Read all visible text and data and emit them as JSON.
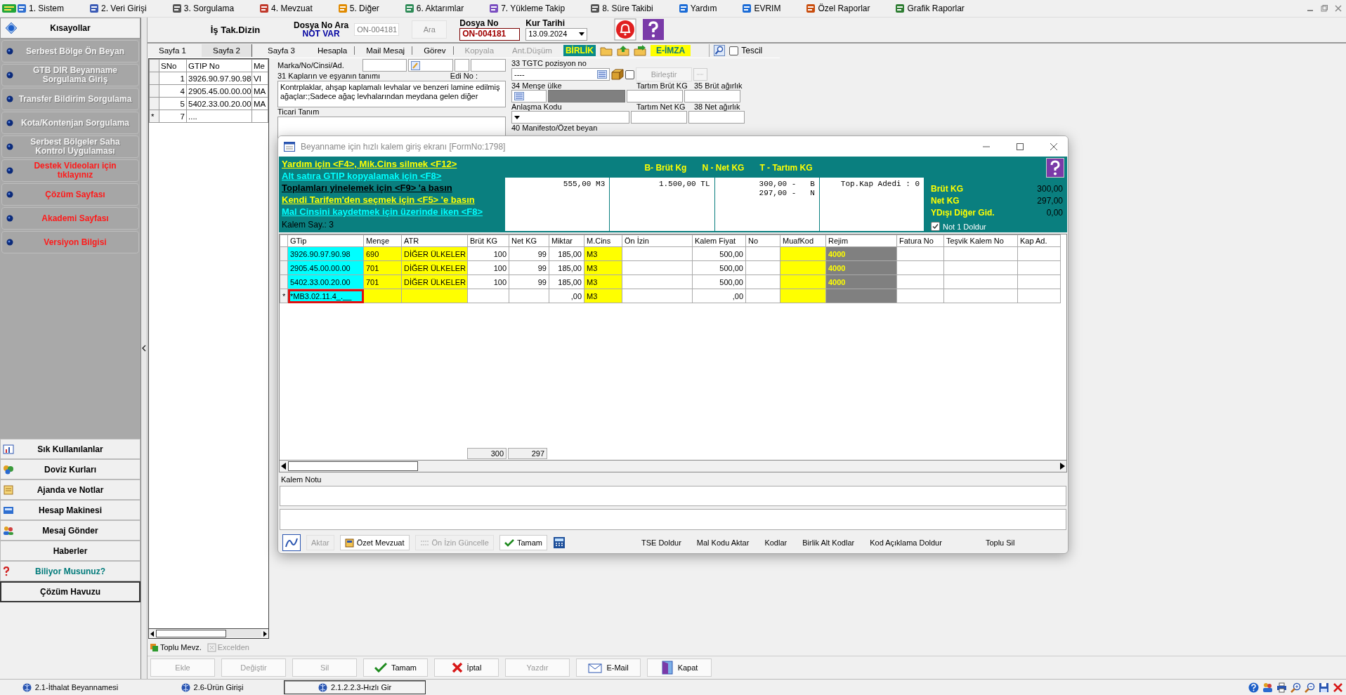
{
  "menu_bar": [
    {
      "label": "1. Sistem"
    },
    {
      "label": "2. Veri Girişi"
    },
    {
      "label": "3. Sorgulama"
    },
    {
      "label": "4. Mevzuat"
    },
    {
      "label": "5. Diğer"
    },
    {
      "label": "6. Aktarımlar"
    },
    {
      "label": "7. Yükleme Takip"
    },
    {
      "label": "8. Süre Takibi"
    },
    {
      "label": "Yardım"
    },
    {
      "label": "EVRIM"
    },
    {
      "label": "Özel Raporlar"
    },
    {
      "label": "Grafik Raporlar"
    }
  ],
  "sidebar": {
    "title": "Kısayollar",
    "items": [
      {
        "label": "Serbest Bölge Ön Beyan",
        "kind": "normal"
      },
      {
        "label": "GTB DIR Beyanname Sorgulama Giriş",
        "kind": "normal"
      },
      {
        "label": "Transfer Bildirim Sorgulama",
        "kind": "normal"
      },
      {
        "label": "Kota/Kontenjan Sorgulama",
        "kind": "normal"
      },
      {
        "label": "Serbest Bölgeler Saha Kontrol Uygulaması",
        "kind": "normal"
      },
      {
        "label": "Destek Videoları için tıklayınız",
        "kind": "highlight"
      },
      {
        "label": "Çözüm Sayfası",
        "kind": "highlight"
      },
      {
        "label": "Akademi Sayfası",
        "kind": "highlight"
      },
      {
        "label": "Versiyon Bilgisi",
        "kind": "highlight"
      }
    ],
    "panels": [
      {
        "label": "Sık Kullanılanlar",
        "kind": "chart"
      },
      {
        "label": "Doviz Kurları",
        "kind": "coins"
      },
      {
        "label": "Ajanda ve Notlar",
        "kind": "notepad"
      },
      {
        "label": "Hesap Makinesi",
        "kind": "calculator"
      },
      {
        "label": "Mesaj Gönder",
        "kind": "people"
      },
      {
        "label": "Haberler",
        "kind": "plain"
      },
      {
        "label": "Biliyor Musunuz?",
        "kind": "tip"
      },
      {
        "label": "Çözüm Havuzu",
        "kind": "boxed"
      }
    ]
  },
  "header": {
    "title": "İş Tak.Dizin",
    "search_label": "Dosya No Ara",
    "search_status": "NOT VAR",
    "search_value": "ON-004181",
    "search_button": "Ara",
    "file_label": "Dosya No",
    "file_value": "ON-004181",
    "date_label": "Kur Tarihi",
    "date_value": "13.09.2024"
  },
  "tabs": [
    {
      "label": "Sayfa 1",
      "selected": false
    },
    {
      "label": "Sayfa 2",
      "selected": true
    },
    {
      "label": "Sayfa 3",
      "selected": false
    }
  ],
  "actions": [
    {
      "label": "Hesapla",
      "disabled": false
    },
    {
      "label": "Mail Mesaj",
      "disabled": false
    },
    {
      "label": "Görev",
      "disabled": false
    },
    {
      "label": "Kopyala",
      "disabled": true
    },
    {
      "label": "Ant.Düşüm",
      "disabled": true
    }
  ],
  "birlik": "BİRLİK",
  "e_imza": "E-İMZA",
  "tescil": {
    "label": "Tescil",
    "checked": false
  },
  "item_list": {
    "columns": [
      "SNo",
      "GTIP No",
      "Me"
    ],
    "rows": [
      {
        "sno": "1",
        "gtip_no": "3926.90.97.90.98",
        "column_3": "VI"
      },
      {
        "sno": "4",
        "gtip_no": "2905.45.00.00.00",
        "column_3": "MA"
      },
      {
        "sno": "5",
        "gtip_no": "5402.33.00.20.00",
        "column_3": "MA"
      },
      {
        "marker": "*",
        "sno": "7",
        "gtip_no": "...."
      }
    ],
    "buttons": [
      {
        "label": "Toplu Mevz.",
        "disabled": false
      },
      {
        "label": "Excelden",
        "disabled": true
      }
    ]
  },
  "form": {
    "brand_label": "Marka/No/Cinsi/Ad.",
    "description_label": "31 Kapların ve eşyanın tanımı",
    "edi_label": "Edi No :",
    "description": "Kontrplaklar, ahşap kaplamalı levhalar ve benzeri lamine edilmiş ağaçlar:;Sadece ağaç levhalarından meydana gelen diğer",
    "trade_label": "Ticari Tanım",
    "tgtc_label": "33 TGTC pozisyon no",
    "tgtc_value": "----",
    "merge_check": {
      "checked": false
    },
    "merge_button": "Birleştir",
    "origin_label": "34 Menşe ülke",
    "tare_gross_label": "Tartım Brüt KG",
    "gross_label": "35 Brüt ağırlık",
    "agreement_label": "Anlaşma Kodu",
    "tare_net_label": "Tartım Net KG",
    "net_label": "38 Net ağırlık",
    "manifest_label": "40 Manifesto/Özet beyan"
  },
  "dialog": {
    "title": "Beyanname için hızlı kalem giriş ekranı [FormNo:1798]",
    "hints": [
      {
        "text": "Yardım için <F4>, Mik.Cins silmek <F12>",
        "color": "#ffff00"
      },
      {
        "text": "Alt satıra GTIP kopyalamak için <F8>",
        "color": "#00ffff"
      },
      {
        "text": "Toplamları yinelemek için <F9> 'a basın",
        "color": "#000000"
      },
      {
        "text": "Kendi Tarifem'den seçmek  için <F5> 'e basın",
        "color": "#ffff00"
      },
      {
        "text": "Mal Cinsini kaydetmek için üzerinde iken <F8>",
        "color": "#00ffff"
      }
    ],
    "item_count": "Kalem Say.: 3",
    "legend": [
      "B- Brüt Kg",
      "N - Net KG",
      "T - Tartım KG"
    ],
    "summary": [
      [
        "555,00 M3"
      ],
      [
        "1.500,00 TL"
      ],
      [
        "300,00 -   B",
        "297,00 -   N"
      ],
      [
        "Top.Kap Adedi : 0"
      ]
    ],
    "totals": [
      {
        "label": "Brüt KG",
        "value": "300,00"
      },
      {
        "label": "Net KG",
        "value": "297,00"
      },
      {
        "label": "YDışı Diğer Gid.",
        "value": "0,00"
      }
    ],
    "note_check": {
      "label": "Not 1 Doldur",
      "checked": true
    },
    "columns": [
      "GTip",
      "Menşe",
      "ATR",
      "Brüt KG",
      "Net KG",
      "Miktar",
      "M.Cins",
      "Ön İzin",
      "Kalem Fiyat",
      "No",
      "MuafKod",
      "Rejim",
      "Fatura No",
      "Teşvik Kalem No",
      "Kap Ad."
    ],
    "rows": [
      {
        "gtip": "3926.90.97.90.98",
        "mense": "690",
        "atr": "DİĞER ÜLKELER",
        "brut_kg": "100",
        "net_kg": "99",
        "miktar": "185,00",
        "m_cins": "M3",
        "kalem_fiyat": "500,00",
        "rejim": "4000",
        "editing": false
      },
      {
        "gtip": "2905.45.00.00.00",
        "mense": "701",
        "atr": "DİĞER ÜLKELER",
        "brut_kg": "100",
        "net_kg": "99",
        "miktar": "185,00",
        "m_cins": "M3",
        "kalem_fiyat": "500,00",
        "rejim": "4000",
        "editing": false
      },
      {
        "gtip": "5402.33.00.20.00",
        "mense": "701",
        "atr": "DİĞER ÜLKELER",
        "brut_kg": "100",
        "net_kg": "99",
        "miktar": "185,00",
        "m_cins": "M3",
        "kalem_fiyat": "500,00",
        "rejim": "4000",
        "editing": false
      },
      {
        "marker": "*",
        "gtip": "*MB3.02.11.4_.__",
        "miktar": ",00",
        "m_cins": "M3",
        "kalem_fiyat": ",00",
        "editing": true
      }
    ],
    "footer_totals": [
      "300",
      "297"
    ],
    "note_label": "Kalem Notu",
    "buttons": [
      {
        "label": "Aktar",
        "disabled": true,
        "kind": "plain"
      },
      {
        "label": "Özet Mevzuat",
        "disabled": false,
        "kind": "book"
      },
      {
        "label": "Ön İzin Güncelle",
        "disabled": true,
        "kind": "grid"
      },
      {
        "label": "Tamam",
        "disabled": false,
        "kind": "check"
      }
    ],
    "links": [
      "TSE Doldur",
      "Mal Kodu Aktar",
      "Kodlar",
      "Birlik Alt Kodlar",
      "Kod Açıklama Doldur",
      "Toplu Sil"
    ]
  },
  "bottom_buttons": [
    {
      "label": "Ekle",
      "disabled": true,
      "kind": "plain"
    },
    {
      "label": "Değiştir",
      "disabled": true,
      "kind": "plain"
    },
    {
      "label": "Sil",
      "disabled": true,
      "kind": "plain"
    },
    {
      "label": "Tamam",
      "disabled": false,
      "kind": "check"
    },
    {
      "label": "İptal",
      "disabled": false,
      "kind": "cross"
    },
    {
      "label": "Yazdır",
      "disabled": true,
      "kind": "plain"
    },
    {
      "label": "E-Mail",
      "disabled": false,
      "kind": "mail"
    },
    {
      "label": "Kapat",
      "disabled": false,
      "kind": "door"
    }
  ],
  "taskbar": [
    {
      "label": "2.1-İthalat Beyannamesi",
      "selected": false
    },
    {
      "label": "2.6-Ürün Girişi",
      "selected": false
    },
    {
      "label": "2.1.2.2.3-Hızlı Gir",
      "selected": true
    }
  ]
}
